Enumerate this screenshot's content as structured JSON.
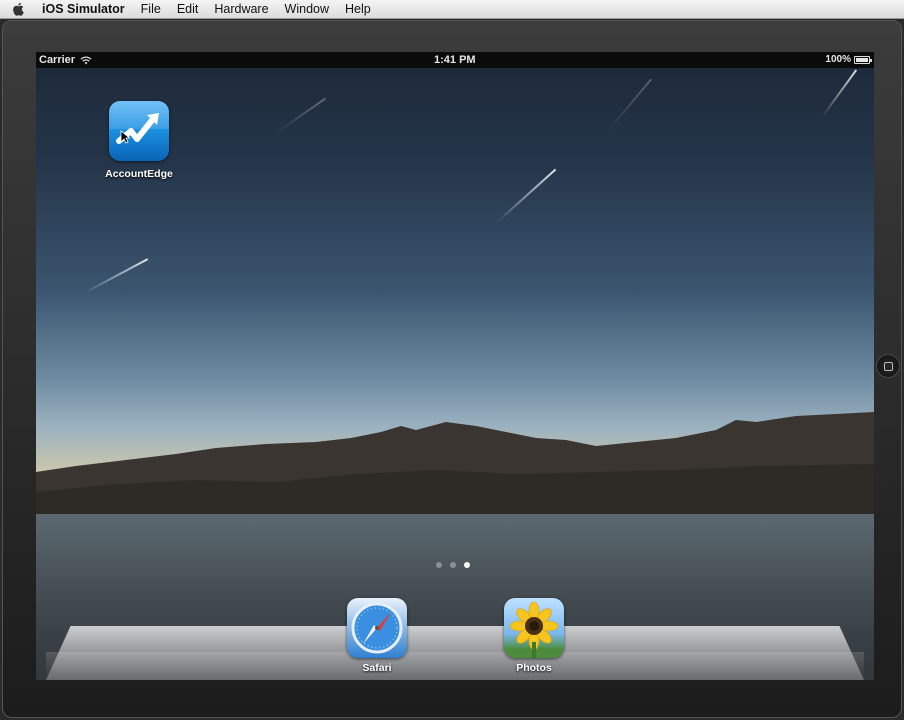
{
  "menubar": {
    "app_name": "iOS Simulator",
    "items": [
      "File",
      "Edit",
      "Hardware",
      "Window",
      "Help"
    ]
  },
  "statusbar": {
    "carrier": "Carrier",
    "time": "1:41 PM",
    "battery": "100%",
    "battery_level": 1.0
  },
  "home_screen": {
    "apps": [
      {
        "label": "AccountEdge",
        "icon": "accountedge-icon"
      }
    ],
    "page_count": 3,
    "active_page": 2,
    "dock": [
      {
        "label": "Safari",
        "icon": "safari-compass-icon"
      },
      {
        "label": "Photos",
        "icon": "sunflower-icon"
      }
    ]
  },
  "colors": {
    "accountedge_blue": "#1b8fe0",
    "safari_blue": "#2f7fd1",
    "status_bar": "#0b0b0b"
  }
}
